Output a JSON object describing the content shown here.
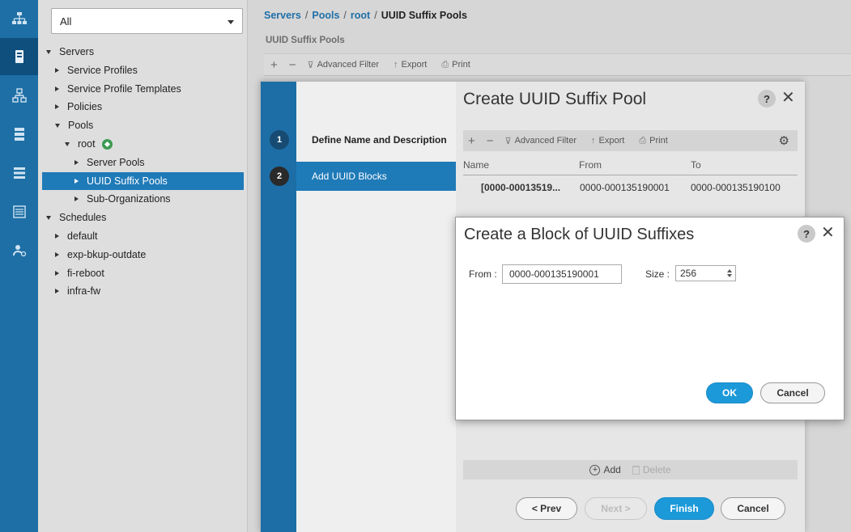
{
  "rail": {
    "icons": [
      "network-icon",
      "server-icon",
      "topology-icon",
      "storage-icon",
      "list-icon",
      "log-icon",
      "admin-icon"
    ],
    "active_index": 1
  },
  "nav": {
    "filter_value": "All",
    "tree": [
      {
        "label": "Servers",
        "level": 0,
        "expand": "down"
      },
      {
        "label": "Service Profiles",
        "level": 1,
        "expand": "right"
      },
      {
        "label": "Service Profile Templates",
        "level": 1,
        "expand": "right"
      },
      {
        "label": "Policies",
        "level": 1,
        "expand": "right"
      },
      {
        "label": "Pools",
        "level": 1,
        "expand": "down"
      },
      {
        "label": "root",
        "level": 2,
        "expand": "down"
      },
      {
        "label": "Server Pools",
        "level": 3,
        "expand": "right"
      },
      {
        "label": "UUID Suffix Pools",
        "level": 3,
        "expand": "right",
        "selected": true
      },
      {
        "label": "Sub-Organizations",
        "level": 3,
        "expand": "right"
      },
      {
        "label": "Schedules",
        "level": 0,
        "expand": "down"
      },
      {
        "label": "default",
        "level": 1,
        "expand": "right"
      },
      {
        "label": "exp-bkup-outdate",
        "level": 1,
        "expand": "right"
      },
      {
        "label": "fi-reboot",
        "level": 1,
        "expand": "right"
      },
      {
        "label": "infra-fw",
        "level": 1,
        "expand": "right"
      }
    ]
  },
  "breadcrumb": {
    "items": [
      "Servers",
      "Pools",
      "root"
    ],
    "separator": "/",
    "current": "UUID Suffix Pools"
  },
  "main": {
    "section_title": "UUID Suffix Pools",
    "toolbar": {
      "add": "+",
      "remove": "−",
      "filter": "Advanced Filter",
      "export": "Export",
      "print": "Print"
    }
  },
  "wizard": {
    "title": "Create UUID Suffix Pool",
    "help": "?",
    "steps": [
      {
        "number": "1",
        "label": "Define Name and Description"
      },
      {
        "number": "2",
        "label": "Add UUID Blocks"
      }
    ],
    "active_step": 1,
    "toolbar": {
      "add": "+",
      "remove": "−",
      "filter": "Advanced Filter",
      "export": "Export",
      "print": "Print"
    },
    "table": {
      "columns": [
        "Name",
        "From",
        "To"
      ],
      "rows": [
        {
          "name": "[0000-00013519...",
          "from": "0000-000135190001",
          "to": "0000-000135190100"
        }
      ]
    },
    "add_label": "Add",
    "delete_label": "Delete",
    "buttons": {
      "prev": "< Prev",
      "next": "Next >",
      "finish": "Finish",
      "cancel": "Cancel"
    }
  },
  "dialog": {
    "title": "Create a Block of UUID Suffixes",
    "help": "?",
    "from_label": "From :",
    "from_value": "0000-000135190001",
    "size_label": "Size :",
    "size_value": "256",
    "ok": "OK",
    "cancel": "Cancel"
  },
  "colors": {
    "rail": "#1e6fa5",
    "selection": "#1f7ab8",
    "link": "#1f6fa8",
    "primary_button": "#1c99d9"
  }
}
